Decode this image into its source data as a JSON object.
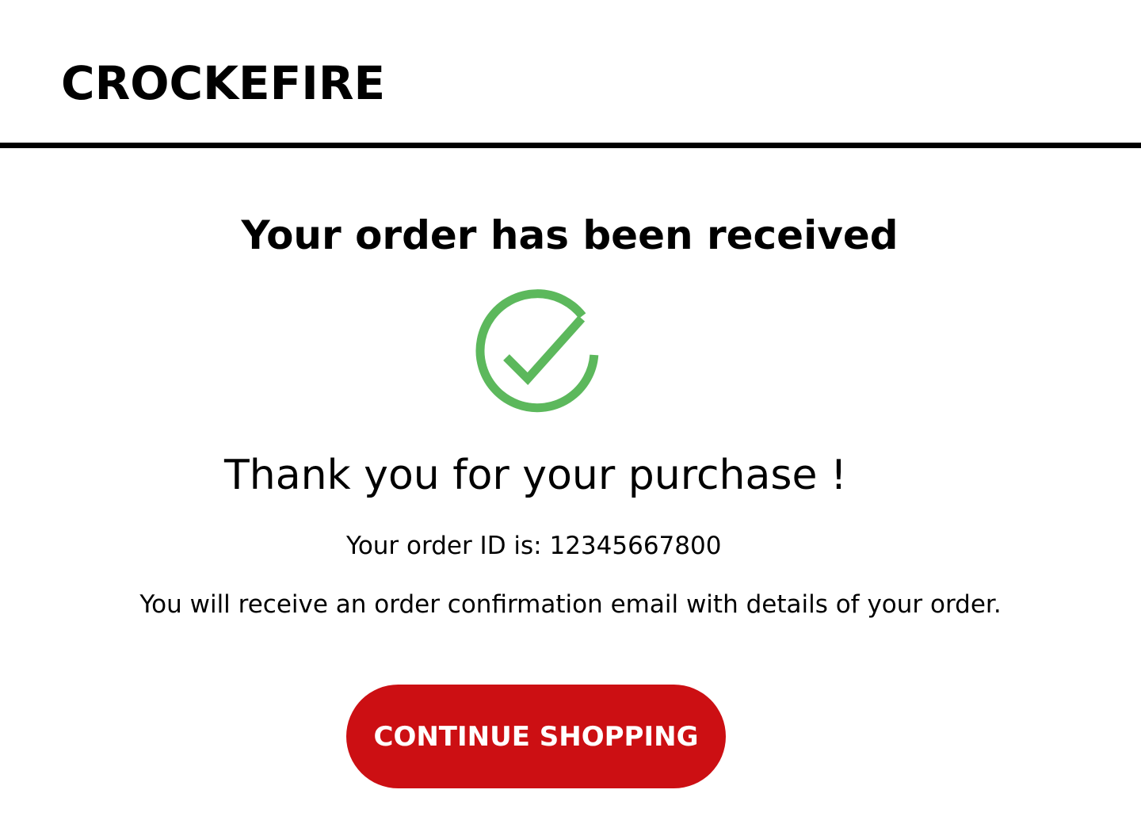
{
  "brand": {
    "name": "CROCKEFIRE"
  },
  "confirmation": {
    "heading": "Your order has been received",
    "status_icon": "check-circle-icon",
    "status_color": "#5cb85c",
    "thank_you": "Thank you for your purchase !",
    "order_id_label": "Your order ID is:",
    "order_id_value": "12345667800",
    "email_notice": "You will receive an order confirmation email with details of your order."
  },
  "actions": {
    "continue_label": "CONTINUE SHOPPING",
    "continue_color": "#cc0f13"
  }
}
